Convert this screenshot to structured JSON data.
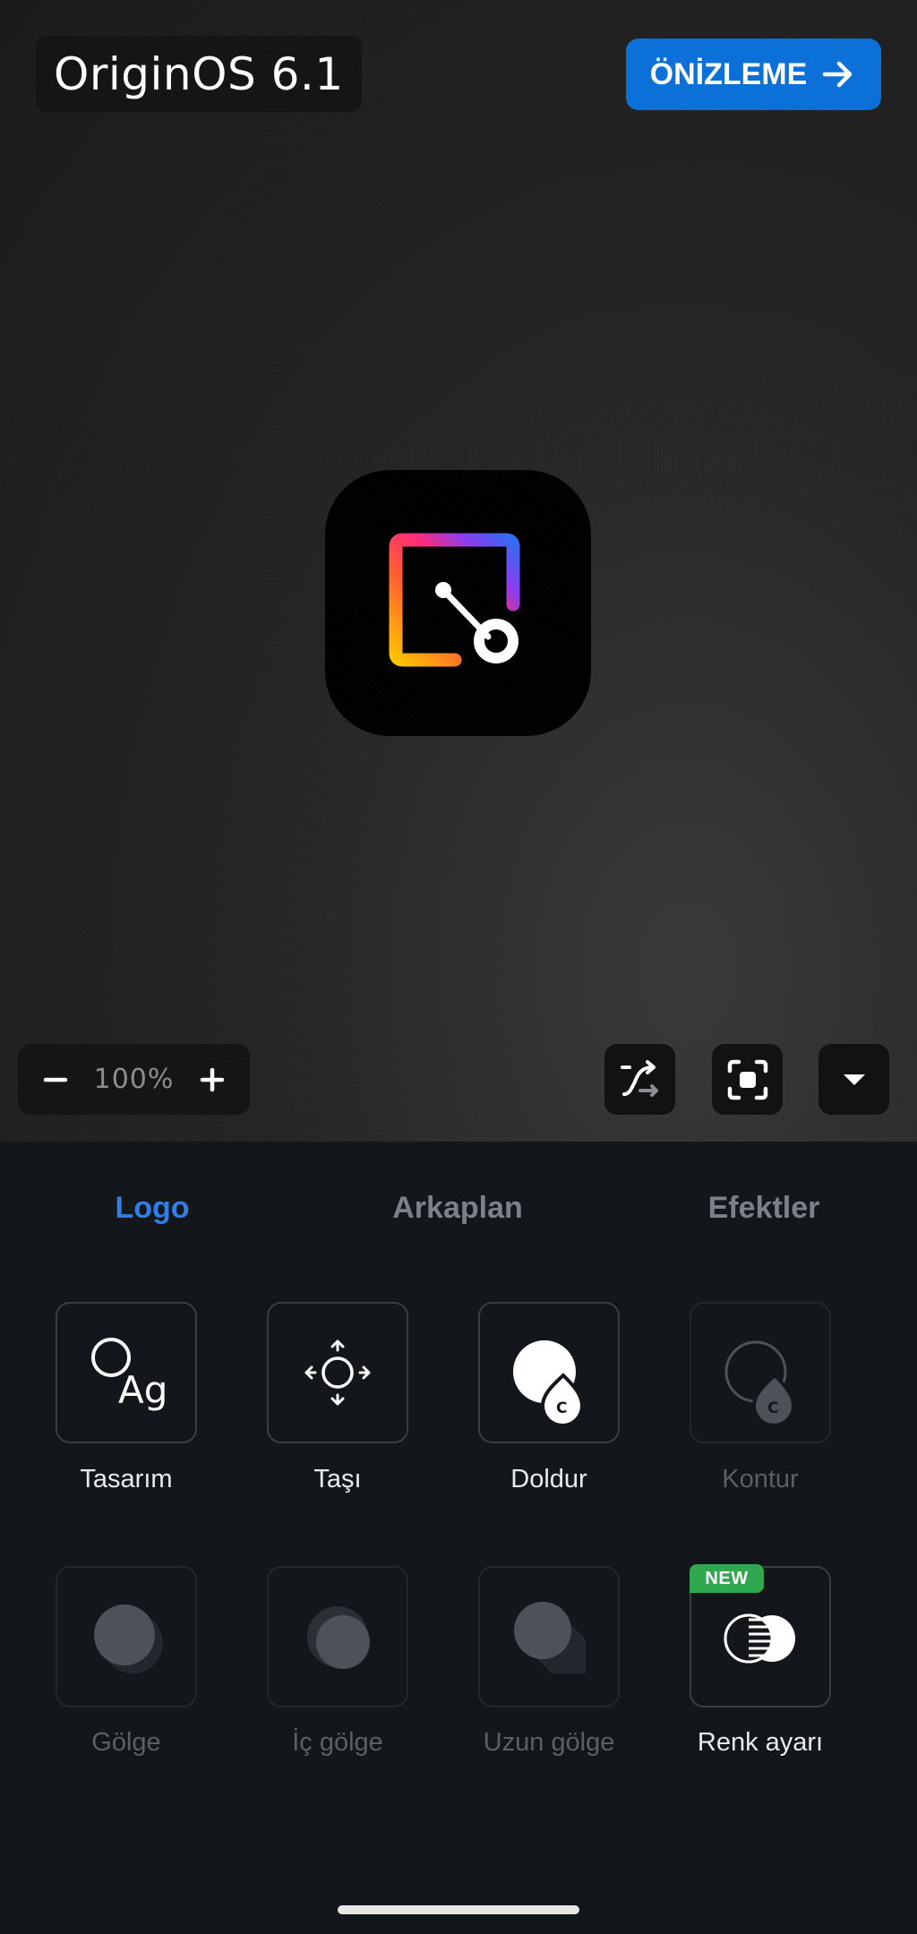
{
  "canvas": {
    "os_label": "OriginOS 6.1",
    "preview_button": "ÖNİZLEME",
    "zoom": {
      "value": "100%"
    }
  },
  "tabs": [
    {
      "label": "Logo",
      "active": true
    },
    {
      "label": "Arkaplan",
      "active": false
    },
    {
      "label": "Efektler",
      "active": false
    }
  ],
  "tools": [
    {
      "label": "Tasarım",
      "enabled": true,
      "icon": "design-ag-icon"
    },
    {
      "label": "Taşı",
      "enabled": true,
      "icon": "move-icon"
    },
    {
      "label": "Doldur",
      "enabled": true,
      "icon": "fill-drop-icon"
    },
    {
      "label": "Kontur",
      "enabled": false,
      "icon": "stroke-drop-icon"
    },
    {
      "label": "Gölge",
      "enabled": false,
      "icon": "shadow-icon"
    },
    {
      "label": "İç gölge",
      "enabled": false,
      "icon": "inner-shadow-icon"
    },
    {
      "label": "Uzun gölge",
      "enabled": false,
      "icon": "long-shadow-icon"
    },
    {
      "label": "Renk ayarı",
      "enabled": true,
      "icon": "color-adjust-icon",
      "badge": "NEW"
    }
  ],
  "colors": {
    "accent": "#0a6fd8",
    "tab_active": "#2f7fe6",
    "badge": "#2fa84f"
  }
}
